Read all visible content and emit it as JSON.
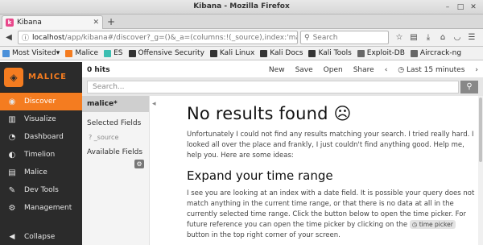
{
  "window": {
    "title": "Kibana - Mozilla Firefox"
  },
  "tab": {
    "title": "Kibana",
    "icon_letter": "k"
  },
  "nav": {
    "url_host": "localhost",
    "url_path": "/app/kibana#/discover?_g=()&_a=(columns:!(_source),index:'malice",
    "search_placeholder": "Search"
  },
  "bookmarks": [
    {
      "label": "Most Visited",
      "color": "#4a90d9"
    },
    {
      "label": "Malice",
      "color": "#f47c20"
    },
    {
      "label": "ES",
      "color": "#3cbeb1"
    },
    {
      "label": "Offensive Security",
      "color": "#333333"
    },
    {
      "label": "Kali Linux",
      "color": "#333333"
    },
    {
      "label": "Kali Docs",
      "color": "#333333"
    },
    {
      "label": "Kali Tools",
      "color": "#333333"
    },
    {
      "label": "Exploit-DB",
      "color": "#666666"
    },
    {
      "label": "Aircrack-ng",
      "color": "#666666"
    }
  ],
  "app": {
    "logo_text": "MALICE",
    "sidebar": {
      "items": [
        {
          "label": "Discover",
          "icon": "compass-icon",
          "glyph": "◉",
          "active": true
        },
        {
          "label": "Visualize",
          "icon": "bar-chart-icon",
          "glyph": "▥",
          "active": false
        },
        {
          "label": "Dashboard",
          "icon": "dashboard-icon",
          "glyph": "◔",
          "active": false
        },
        {
          "label": "Timelion",
          "icon": "timelion-icon",
          "glyph": "◐",
          "active": false
        },
        {
          "label": "Malice",
          "icon": "malice-icon",
          "glyph": "▤",
          "active": false
        },
        {
          "label": "Dev Tools",
          "icon": "wrench-icon",
          "glyph": "✎",
          "active": false
        },
        {
          "label": "Management",
          "icon": "gear-icon",
          "glyph": "⚙",
          "active": false
        }
      ],
      "collapse_label": "Collapse"
    },
    "topnav": {
      "hits": "0 hits",
      "new": "New",
      "save": "Save",
      "open": "Open",
      "share": "Share",
      "time": "Last 15 minutes"
    },
    "query": {
      "placeholder": "Search..."
    },
    "fields": {
      "index_pattern": "malice*",
      "selected_heading": "Selected Fields",
      "selected_field": "_source",
      "available_heading": "Available Fields"
    },
    "content": {
      "title": "No results found ☹",
      "intro": "Unfortunately I could not find any results matching your search. I tried really hard. I looked all over the place and frankly, I just couldn't find anything good. Help me, help you. Here are some ideas:",
      "section_title": "Expand your time range",
      "section_body_1": "I see you are looking at an index with a date field. It is possible your query does not match anything in the current time range, or that there is no data at all in the currently selected time range. Click the button below to open the time picker. For future reference you can open the time picker by clicking on the",
      "time_picker_badge": "time picker",
      "section_body_2": "button in the top right corner of your screen."
    }
  }
}
